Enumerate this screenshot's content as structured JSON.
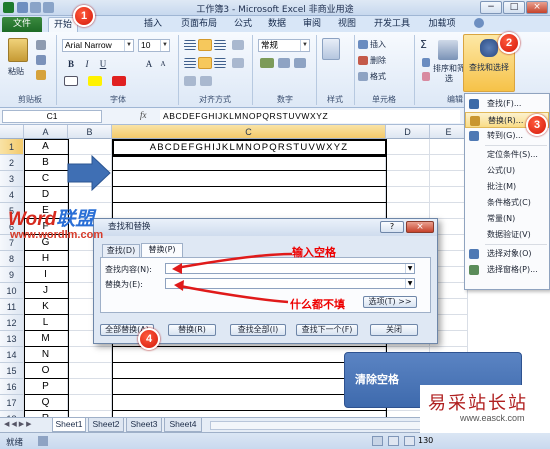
{
  "window": {
    "title": "工作簿3 - Microsoft Excel 非商业用途",
    "controls": [
      "−",
      "□",
      "×"
    ]
  },
  "ribbon_tabs": [
    "文件",
    "开始",
    "插入",
    "页面布局",
    "公式",
    "数据",
    "审阅",
    "视图",
    "开发工具",
    "加载项"
  ],
  "ribbon": {
    "clipboard": {
      "paste": "粘贴",
      "label": "剪贴板"
    },
    "font": {
      "name": "Arial Narrow",
      "size": "10",
      "label": "字体",
      "bold": "B",
      "italic": "I",
      "underline": "U",
      "grow": "A",
      "shrink": "A"
    },
    "alignment": {
      "label": "对齐方式"
    },
    "number": {
      "format": "常规",
      "label": "数字"
    },
    "styles": {
      "label": "样式"
    },
    "cells": {
      "insert": "插入",
      "delete": "删除",
      "format": "格式",
      "label": "单元格"
    },
    "editing": {
      "sum": "Σ",
      "sort_filter": "排序和筛选",
      "find_select": "查找和选择",
      "label": "编辑"
    }
  },
  "formula_bar": {
    "name_box": "C1",
    "fx": "fx",
    "content": "ABCDEFGHIJKLMNOPQRSTUVWXYZ"
  },
  "columns": [
    "A",
    "B",
    "C",
    "D",
    "E"
  ],
  "rows": [
    "1",
    "2",
    "3",
    "4",
    "5",
    "6",
    "7",
    "8",
    "9",
    "10",
    "11",
    "12",
    "13",
    "14",
    "15",
    "16",
    "17",
    "18",
    "19"
  ],
  "column_a": [
    "A",
    "B",
    "C",
    "D",
    "E",
    "F",
    "G",
    "H",
    "I",
    "J",
    "K",
    "L",
    "M",
    "N",
    "O",
    "P",
    "Q",
    "R",
    "S"
  ],
  "cell_c1": "ABCDEFGHIJKLMNOPQRSTUVWXYZ",
  "find_menu": [
    {
      "label": "查找(F)...",
      "color": "#3c6aa8"
    },
    {
      "label": "替换(R)...",
      "color": "#c9962f"
    },
    {
      "label": "转到(G)...",
      "color": "#4f79b4"
    },
    {
      "label": "定位条件(S)...",
      "color": ""
    },
    {
      "label": "公式(U)",
      "color": ""
    },
    {
      "label": "批注(M)",
      "color": ""
    },
    {
      "label": "条件格式(C)",
      "color": ""
    },
    {
      "label": "常量(N)",
      "color": ""
    },
    {
      "label": "数据验证(V)",
      "color": ""
    },
    {
      "label": "选择对象(O)",
      "color": "#4f79b4"
    },
    {
      "label": "选择窗格(P)...",
      "color": "#5b8c5a"
    }
  ],
  "dialog": {
    "title": "查找和替换",
    "help": "?",
    "close": "×",
    "tabs": [
      "查找(D)",
      "替换(P)"
    ],
    "find_label": "查找内容(N):",
    "replace_label": "替换为(E):",
    "find_value": "",
    "replace_value": "",
    "options_button": "选项(T) >>",
    "buttons": [
      "全部替换(A)",
      "替换(R)",
      "查找全部(I)",
      "查找下一个(F)",
      "关闭"
    ]
  },
  "sheets": [
    "Sheet1",
    "Sheet2",
    "Sheet3",
    "Sheet4"
  ],
  "status": {
    "mode": "就绪",
    "zoom": "130"
  },
  "annotations": {
    "badges": [
      "1",
      "2",
      "3",
      "4"
    ],
    "input_space": "输入空格",
    "leave_empty": "什么都不填",
    "callout": "清除空格"
  },
  "watermark": {
    "logo_word": "Word",
    "logo_cn": "联盟",
    "url": "www.wordlm.com"
  },
  "site": {
    "name": "易采站长站",
    "url": "www.easck.com"
  }
}
